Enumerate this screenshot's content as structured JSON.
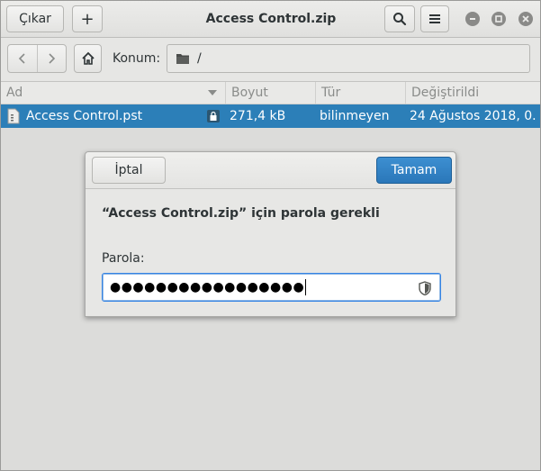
{
  "header": {
    "eject_label": "Çıkar",
    "add_label": "+",
    "title": "Access Control.zip"
  },
  "location": {
    "label": "Konum:",
    "path": "/"
  },
  "columns": {
    "name": "Ad",
    "size": "Boyut",
    "type": "Tür",
    "modified": "Değiştirildi"
  },
  "file": {
    "name": "Access Control.pst",
    "size": "271,4 kB",
    "type": "bilinmeyen",
    "modified": "24 Ağustos 2018, 0..."
  },
  "dialog": {
    "cancel_label": "İptal",
    "ok_label": "Tamam",
    "message": "“Access Control.zip” için parola gerekli",
    "password_label": "Parola:",
    "password_value": "●●●●●●●●●●●●●●●●●"
  },
  "colors": {
    "selection": "#2c7fb8",
    "accent": "#2a77b9",
    "focus": "#3584e4"
  }
}
